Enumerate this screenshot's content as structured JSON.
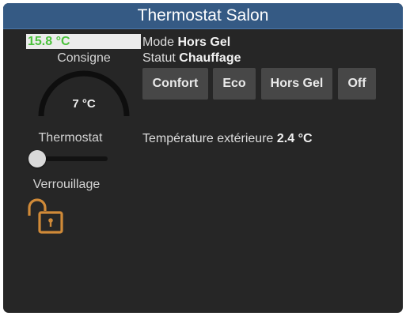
{
  "widget": {
    "title": "Thermostat Salon"
  },
  "current_temperature": "15.8 °C",
  "setpoint": {
    "label": "Consigne",
    "value": "7 °C"
  },
  "status": {
    "mode_label": "Mode",
    "mode_value": "Hors Gel",
    "statut_label": "Statut",
    "statut_value": "Chauffage"
  },
  "mode_buttons": [
    "Confort",
    "Eco",
    "Hors Gel",
    "Off"
  ],
  "outdoor": {
    "label": "Température extérieure",
    "value": "2.4 °C"
  },
  "thermostat": {
    "label": "Thermostat",
    "level": 0.07
  },
  "lock": {
    "label": "Verrouillage",
    "icon": "lock-open-icon",
    "state": "unlocked",
    "color": "#d08a38"
  },
  "colors": {
    "title_bar": "#355a84",
    "panel_bg": "#262626",
    "temp_text": "#4cc23d",
    "button_bg": "#474747"
  }
}
